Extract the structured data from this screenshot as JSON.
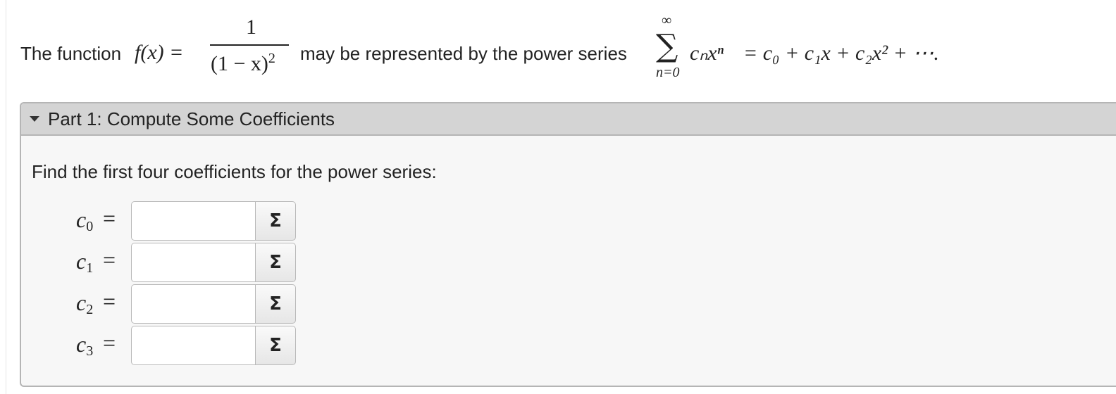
{
  "intro": {
    "text_before": "The function",
    "func_lhs": "f(x) =",
    "frac_num": "1",
    "frac_den": "(1 − x)",
    "frac_den_exp": "2",
    "text_middle": "may be represented by the power series",
    "sum_upper": "∞",
    "sum_symbol": "∑",
    "sum_lower": "n=0",
    "series_term": "cₙxⁿ",
    "series_rhs": "= c₀ + c₁x + c₂x² + ⋯."
  },
  "part": {
    "title": "Part 1: Compute Some Coefficients",
    "instruction": "Find the first four coefficients for the power series:",
    "rows": [
      {
        "var": "c",
        "sub": "0",
        "eq": "=",
        "value": "",
        "button": "Σ"
      },
      {
        "var": "c",
        "sub": "1",
        "eq": "=",
        "value": "",
        "button": "Σ"
      },
      {
        "var": "c",
        "sub": "2",
        "eq": "=",
        "value": "",
        "button": "Σ"
      },
      {
        "var": "c",
        "sub": "3",
        "eq": "=",
        "value": "",
        "button": "Σ"
      }
    ]
  }
}
